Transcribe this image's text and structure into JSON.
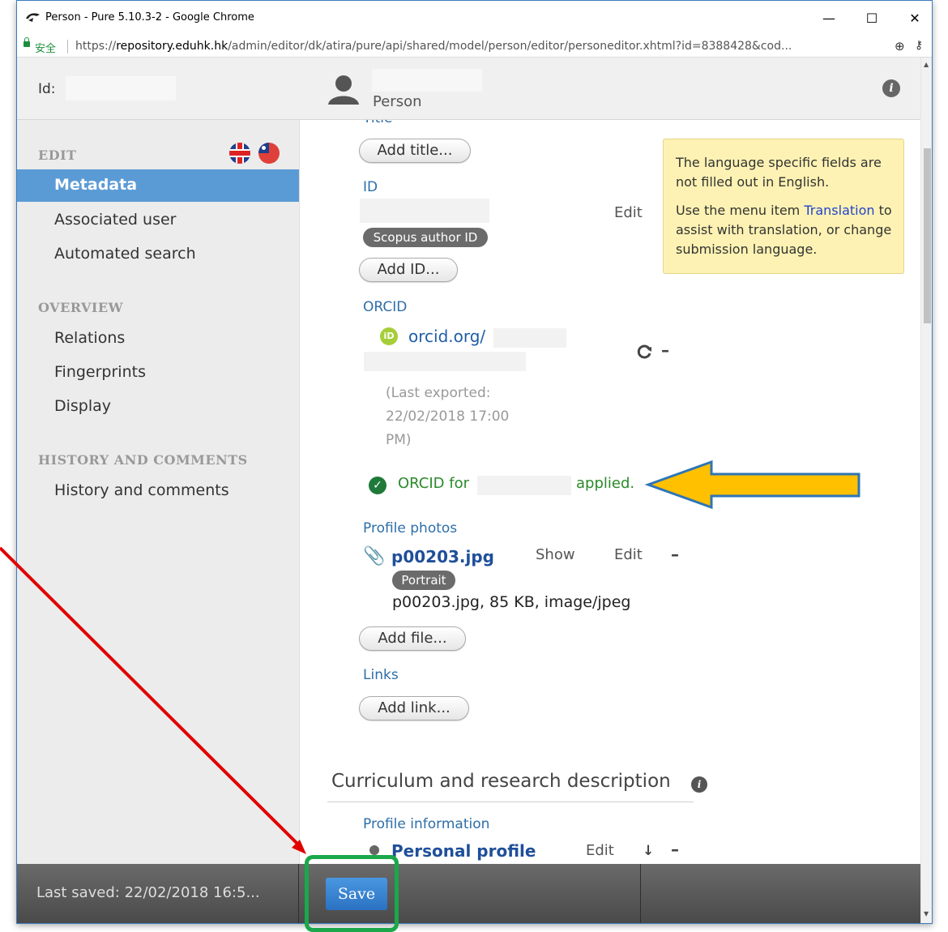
{
  "browser": {
    "tab_title": "Person - Pure 5.10.3-2 - Google Chrome",
    "secure_label": "安全",
    "url_prefix": "https://",
    "url_host": "repository.eduhk.hk",
    "url_path": "/admin/editor/dk/atira/pure/api/shared/model/person/editor/personeditor.xhtml?id=8388428&cod...",
    "controls": {
      "minimize": "—",
      "maximize": "☐",
      "close": "✕"
    }
  },
  "header": {
    "id_label": "Id:",
    "person_label": "Person"
  },
  "sidebar": {
    "edit_heading": "EDIT",
    "edit_items": [
      "Metadata",
      "Associated user",
      "Automated search"
    ],
    "overview_heading": "OVERVIEW",
    "overview_items": [
      "Relations",
      "Fingerprints",
      "Display"
    ],
    "history_heading": "HISTORY AND COMMENTS",
    "history_items": [
      "History and comments"
    ]
  },
  "content": {
    "title_label": "Title",
    "add_title": "Add title...",
    "id_label": "ID",
    "id_edit": "Edit",
    "scopus_tag": "Scopus author ID",
    "add_id": "Add ID...",
    "orcid_label": "ORCID",
    "orcid_link": "orcid.org/",
    "orcid_icon_text": "iD",
    "last_exported_1": "(Last exported:",
    "last_exported_2": "22/02/2018 17:00",
    "last_exported_3": "PM)",
    "orcid_for": "ORCID for",
    "applied": "applied.",
    "profile_photos_label": "Profile photos",
    "photo_file": "p00203.jpg",
    "photo_show": "Show",
    "photo_edit": "Edit",
    "portrait_tag": "Portrait",
    "photo_details": "p00203.jpg, 85 KB, image/jpeg",
    "add_file": "Add file...",
    "links_label": "Links",
    "add_link": "Add link...",
    "curriculum_title": "Curriculum and research description",
    "profile_information_label": "Profile information",
    "personal_profile": "Personal profile",
    "personal_edit": "Edit"
  },
  "tooltip": {
    "line1": "The language specific fields are not filled out in English.",
    "line2_prefix": "Use the menu item ",
    "line2_link": "Translation",
    "line2_suffix": " to assist with translation, or change submission language."
  },
  "footer": {
    "last_saved": "Last saved: 22/02/2018 16:5...",
    "save_label": "Save"
  },
  "colors": {
    "accent_blue": "#5b9bd5",
    "annotation_arrow_fill": "#ffc000",
    "annotation_arrow_outline": "#2e75b6",
    "annotation_red": "#e00000",
    "annotation_green": "#1aa84a"
  }
}
